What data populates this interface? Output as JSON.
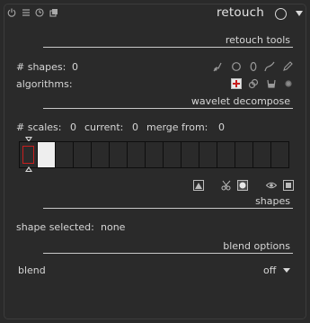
{
  "module": {
    "title": "retouch",
    "header_icons": [
      "power-icon",
      "presets-icon",
      "reset-icon",
      "multi-instance-icon"
    ]
  },
  "retouch_tools": {
    "section_label": "retouch tools",
    "shapes_label": "# shapes:",
    "shapes_value": "0",
    "shape_icons": [
      "brush-icon",
      "circle-icon",
      "ellipse-icon",
      "path-icon",
      "pencil-icon"
    ],
    "algorithms_label": "algorithms:",
    "algorithm_icons": [
      "clone-icon",
      "heal-icon",
      "fill-icon",
      "blur-icon"
    ]
  },
  "wavelet": {
    "section_label": "wavelet decompose",
    "scales_label": "# scales:",
    "scales_value": "0",
    "current_label": "current:",
    "current_value": "0",
    "merge_label": "merge from:",
    "merge_value": "0",
    "cell_count": 15,
    "action_icons": [
      "display-wavelet-scale-icon",
      "cut-paste-icon",
      "auto-levels-icon",
      "preview-icon",
      "suppress-icon"
    ]
  },
  "shapes": {
    "section_label": "shapes",
    "selected_label": "shape selected:",
    "selected_value": "none"
  },
  "blend": {
    "section_label": "blend options",
    "blend_label": "blend",
    "blend_value": "off"
  }
}
